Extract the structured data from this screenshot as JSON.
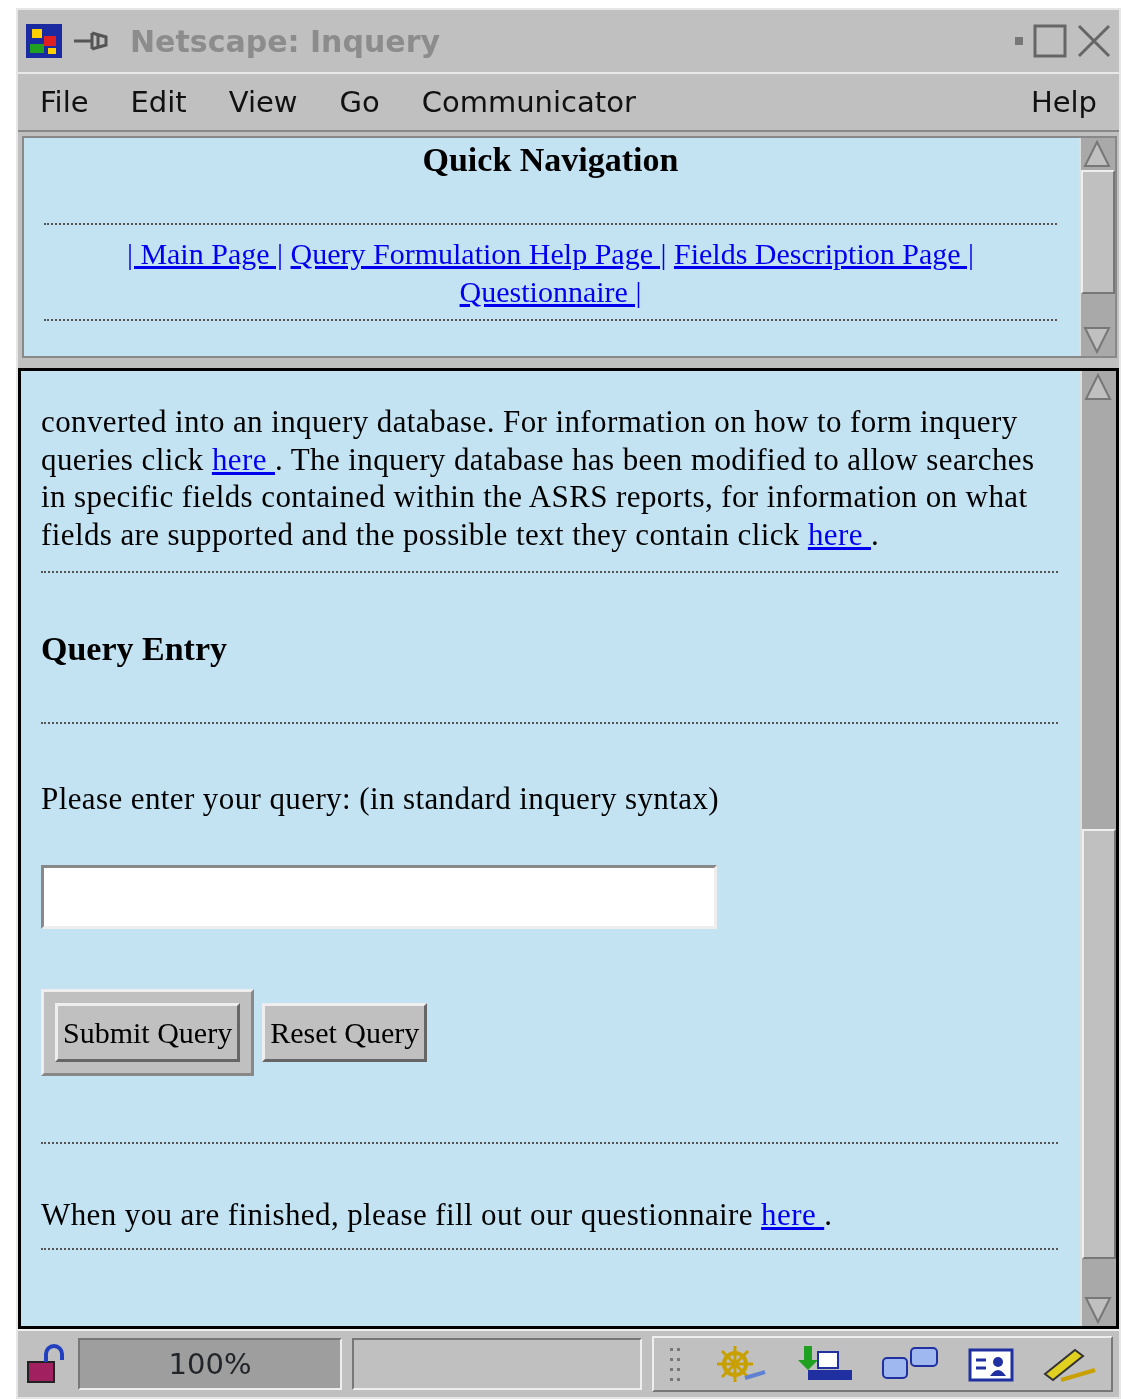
{
  "window": {
    "title": "Netscape: Inquery"
  },
  "menu": [
    "File",
    "Edit",
    "View",
    "Go",
    "Communicator"
  ],
  "help_menu": "Help",
  "nav_frame": {
    "heading": "Quick Navigation",
    "links": [
      "| Main Page |",
      "Query Formulation Help Page |",
      "Fields Description Page |",
      "Questionnaire |"
    ]
  },
  "main_frame": {
    "intro": [
      {
        "kind": "text",
        "text": "converted into an inquery database. For information on how to form inquery queries click "
      },
      {
        "kind": "link",
        "text": "here "
      },
      {
        "kind": "text",
        "text": ". The inquery database has been modified to allow searches in specific fields contained within the ASRS reports, for information on what fields are supported and the possible text they contain click "
      },
      {
        "kind": "link",
        "text": "here "
      },
      {
        "kind": "text",
        "text": "."
      }
    ],
    "heading": "Query Entry",
    "prompt": "Please enter your query: (in standard inquery syntax)",
    "buttons": [
      {
        "label": "Submit Query",
        "default": true
      },
      {
        "label": "Reset Query",
        "default": false
      }
    ],
    "footer": [
      {
        "kind": "text",
        "text": "When you are finished, please fill out our questionnaire "
      },
      {
        "kind": "link",
        "text": "here "
      },
      {
        "kind": "text",
        "text": "."
      }
    ]
  },
  "status_bar": {
    "zoom": "100%"
  }
}
